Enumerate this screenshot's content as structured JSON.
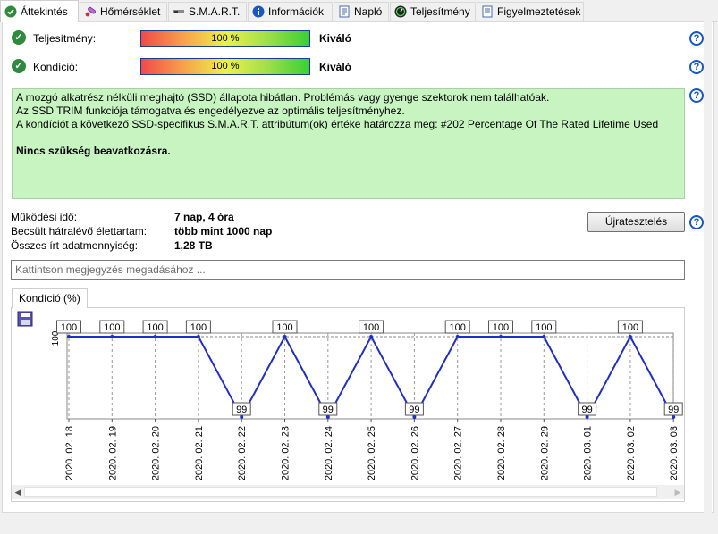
{
  "tabs": [
    {
      "label": "Áttekintés",
      "icon": "check-circle-icon",
      "active": true
    },
    {
      "label": "Hőmérséklet",
      "icon": "thermometer-icon",
      "active": false
    },
    {
      "label": "S.M.A.R.T.",
      "icon": "drive-icon",
      "active": false
    },
    {
      "label": "Információk",
      "icon": "info-icon",
      "active": false
    },
    {
      "label": "Napló",
      "icon": "document-icon",
      "active": false
    },
    {
      "label": "Teljesítmény",
      "icon": "speedometer-icon",
      "active": false
    },
    {
      "label": "Figyelmeztetések",
      "icon": "document-warning-icon",
      "active": false
    }
  ],
  "performance": {
    "label": "Teljesítmény:",
    "value_text": "100 %",
    "value": 100,
    "rating": "Kiváló"
  },
  "condition": {
    "label": "Kondíció:",
    "value_text": "100 %",
    "value": 100,
    "rating": "Kiváló"
  },
  "status_box": {
    "line1": "A mozgó alkatrész nélküli meghajtó (SSD) állapota hibátlan. Problémás vagy gyenge szektorok nem találhatóak.",
    "line2": "Az SSD TRIM funkciója támogatva és engedélyezve az optimális teljesítményhez.",
    "line3": "A kondíciót a következő SSD-specifikus S.M.A.R.T. attribútum(ok) értéke határozza meg:  #202 Percentage Of The Rated Lifetime Used",
    "action": "Nincs szükség beavatkozásra."
  },
  "info": {
    "uptime_label": "Működési idő:",
    "uptime_value": "7 nap, 4 óra",
    "remaining_label": "Becsült hátralévő élettartam:",
    "remaining_value": "több mint 1000 nap",
    "written_label": "Összes írt adatmennyiség:",
    "written_value": "1,28 TB"
  },
  "retest_button": "Újratesztelés",
  "note_placeholder": "Kattintson megjegyzés megadásához ...",
  "chart_tab": "Kondíció  (%)",
  "colors": {
    "line": "#1f2fc8",
    "status_bg": "#c7f4c1",
    "check": "#2e8b3e",
    "help": "#1a56c4"
  },
  "chart_data": {
    "type": "line",
    "y_tick": "100",
    "ylim": [
      99,
      100
    ],
    "grid": true,
    "series": [
      {
        "values": [
          100,
          100,
          100,
          100,
          99,
          100,
          99,
          100,
          99,
          100,
          100,
          100,
          99,
          100,
          99
        ],
        "labels": [
          "100",
          "100",
          "100",
          "100",
          "99",
          "100",
          "99",
          "100",
          "99",
          "100",
          "100",
          "100",
          "99",
          "100",
          "99"
        ]
      }
    ],
    "x": [
      "2020. 02. 18",
      "2020. 02. 19",
      "2020. 02. 20",
      "2020. 02. 21",
      "2020. 02. 22",
      "2020. 02. 23",
      "2020. 02. 24",
      "2020. 02. 25",
      "2020. 02. 26",
      "2020. 02. 27",
      "2020. 02. 28",
      "2020. 02. 29",
      "2020. 03. 01",
      "2020. 03. 02",
      "2020. 03. 03"
    ]
  }
}
